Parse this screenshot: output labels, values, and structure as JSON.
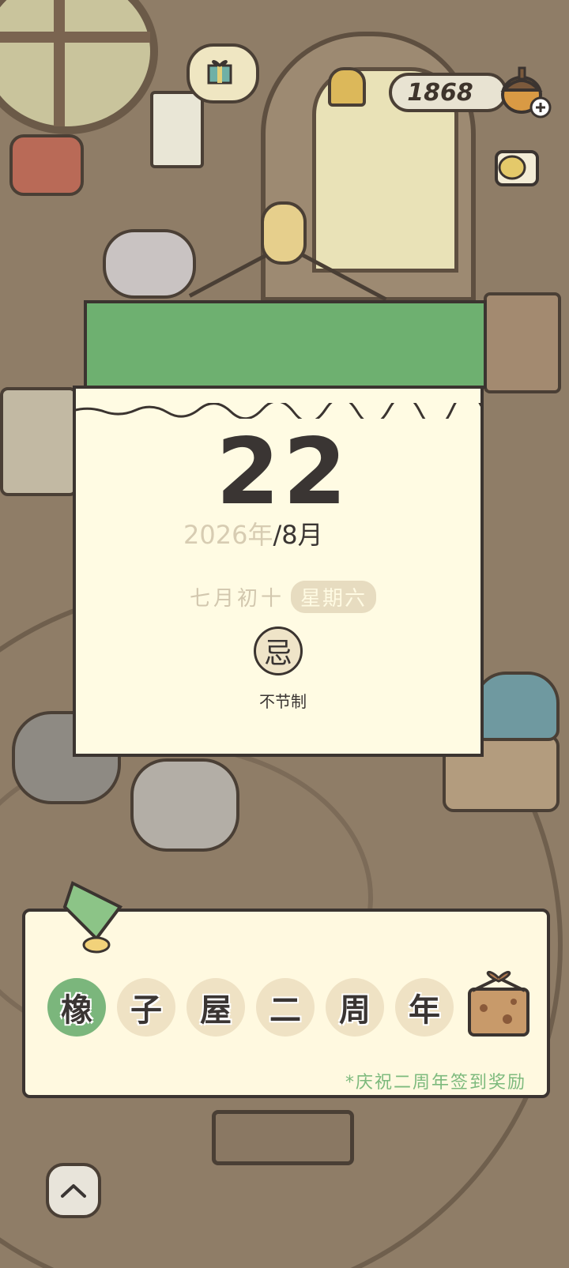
{
  "currency": {
    "amount": "1868"
  },
  "calendar": {
    "day": "22",
    "year": "2026年",
    "month": "/8月",
    "lunar_date": "七月初十",
    "weekday": "星期六",
    "badge": "忌",
    "note": "不节制"
  },
  "banner": {
    "chars": [
      "橡",
      "子",
      "屋",
      "二",
      "周",
      "年"
    ],
    "active_index": 0,
    "reward_text": "*庆祝二周年签到奖励"
  },
  "colors": {
    "calendar_header": "#6eb070",
    "paper": "#fffbe3",
    "accent_green": "#7dba7d",
    "background": "#8f7d67"
  },
  "icons": [
    "acorn-icon",
    "plus-icon",
    "bag-icon",
    "gift-icon",
    "leaf-icon",
    "chevron-up-icon"
  ]
}
